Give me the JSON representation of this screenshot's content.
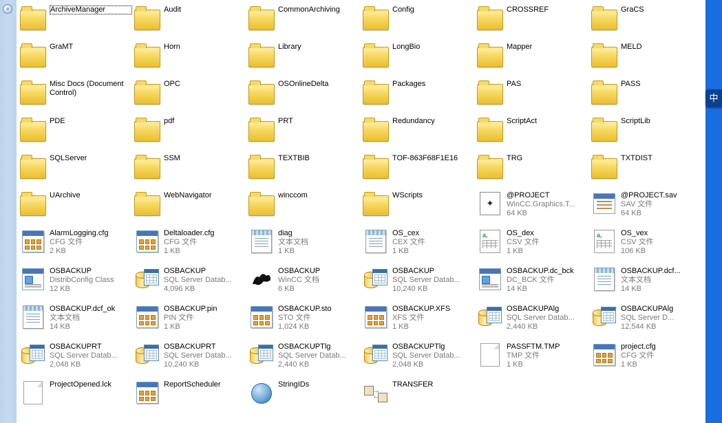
{
  "sticker": "中",
  "items": [
    {
      "name": "ArchiveManager",
      "icon": "folder",
      "dotted": true
    },
    {
      "name": "Audit",
      "icon": "folder"
    },
    {
      "name": "CommonArchiving",
      "icon": "folder"
    },
    {
      "name": "Config",
      "icon": "folder"
    },
    {
      "name": "CROSSREF",
      "icon": "folder"
    },
    {
      "name": "GraCS",
      "icon": "folder"
    },
    {
      "name": "GraMT",
      "icon": "folder"
    },
    {
      "name": "Horn",
      "icon": "folder"
    },
    {
      "name": "Library",
      "icon": "folder"
    },
    {
      "name": "LongBio",
      "icon": "folder"
    },
    {
      "name": "Mapper",
      "icon": "folder"
    },
    {
      "name": "MELD",
      "icon": "folder"
    },
    {
      "name": "Misc Docs (Document Control)",
      "icon": "folder",
      "wrap": true
    },
    {
      "name": "OPC",
      "icon": "folder"
    },
    {
      "name": "OSOnlineDelta",
      "icon": "folder"
    },
    {
      "name": "Packages",
      "icon": "folder"
    },
    {
      "name": "PAS",
      "icon": "folder"
    },
    {
      "name": "PASS",
      "icon": "folder"
    },
    {
      "name": "PDE",
      "icon": "folder"
    },
    {
      "name": "pdf",
      "icon": "folder"
    },
    {
      "name": "PRT",
      "icon": "folder"
    },
    {
      "name": "Redundancy",
      "icon": "folder"
    },
    {
      "name": "ScriptAct",
      "icon": "folder"
    },
    {
      "name": "ScriptLib",
      "icon": "folder"
    },
    {
      "name": "SQLServer",
      "icon": "folder"
    },
    {
      "name": "SSM",
      "icon": "folder"
    },
    {
      "name": "TEXTBIB",
      "icon": "folder"
    },
    {
      "name": "TOF-863F68F1E16",
      "icon": "folder"
    },
    {
      "name": "TRG",
      "icon": "folder"
    },
    {
      "name": "TXTDIST",
      "icon": "folder"
    },
    {
      "name": "UArchive",
      "icon": "folder"
    },
    {
      "name": "WebNavigator",
      "icon": "folder"
    },
    {
      "name": "winccom",
      "icon": "folder"
    },
    {
      "name": "WScripts",
      "icon": "folder"
    },
    {
      "name": "@PROJECT",
      "icon": "gfx",
      "type": "WinCC.Graphics.T...",
      "size": "64 KB"
    },
    {
      "name": "@PROJECT.sav",
      "icon": "sav",
      "type": "SAV 文件",
      "size": "64 KB"
    },
    {
      "name": "AlarmLogging.cfg",
      "icon": "cfg",
      "type": "CFG 文件",
      "size": "2 KB"
    },
    {
      "name": "Deltaloader.cfg",
      "icon": "cfg",
      "type": "CFG 文件",
      "size": "1 KB"
    },
    {
      "name": "diag",
      "icon": "txt",
      "type": "文本文档",
      "size": "1 KB"
    },
    {
      "name": "OS_cex",
      "icon": "txt",
      "type": "CEX 文件",
      "size": "1 KB"
    },
    {
      "name": "OS_dex",
      "icon": "csv",
      "type": "CSV 文件",
      "size": "1 KB"
    },
    {
      "name": "OS_vex",
      "icon": "csv",
      "type": "CSV 文件",
      "size": "106 KB"
    },
    {
      "name": "OSBACKUP",
      "icon": "cfg2",
      "type": "DistribConfig Class",
      "size": "12 KB"
    },
    {
      "name": "OSBACKUP",
      "icon": "db",
      "type": "SQL Server Datab...",
      "size": "4,096 KB"
    },
    {
      "name": "OSBACKUP",
      "icon": "wincc",
      "type": "WinCC 文档",
      "size": "6 KB"
    },
    {
      "name": "OSBACKUP",
      "icon": "db",
      "type": "SQL Server Datab...",
      "size": "10,240 KB"
    },
    {
      "name": "OSBACKUP.dc_bck",
      "icon": "cfg2",
      "type": "DC_BCK 文件",
      "size": "14 KB"
    },
    {
      "name": "OSBACKUP.dcf...",
      "icon": "txt",
      "type": "文本文档",
      "size": "14 KB"
    },
    {
      "name": "OSBACKUP.dcf_ok",
      "icon": "txt",
      "type": "文本文档",
      "size": "14 KB"
    },
    {
      "name": "OSBACKUP.pin",
      "icon": "cfg",
      "type": "PIN 文件",
      "size": "1 KB"
    },
    {
      "name": "OSBACKUP.sto",
      "icon": "cfg",
      "type": "STO 文件",
      "size": "1,024 KB"
    },
    {
      "name": "OSBACKUP.XFS",
      "icon": "cfg",
      "type": "XFS 文件",
      "size": "1 KB"
    },
    {
      "name": "OSBACKUPAlg",
      "icon": "db",
      "type": "SQL Server Datab...",
      "size": "2,440 KB"
    },
    {
      "name": "OSBACKUPAlg",
      "icon": "db",
      "type": "SQL Server D...",
      "size": "12,544 KB"
    },
    {
      "name": "OSBACKUPRT",
      "icon": "db",
      "type": "SQL Server Datab...",
      "size": "2,048 KB"
    },
    {
      "name": "OSBACKUPRT",
      "icon": "db",
      "type": "SQL Server Datab...",
      "size": "10,240 KB"
    },
    {
      "name": "OSBACKUPTlg",
      "icon": "db",
      "type": "SQL Server Datab...",
      "size": "2,440 KB"
    },
    {
      "name": "OSBACKUPTlg",
      "icon": "db",
      "type": "SQL Server Datab...",
      "size": "2,048 KB"
    },
    {
      "name": "PASSFTM.TMP",
      "icon": "sheet",
      "type": "TMP 文件",
      "size": "1 KB"
    },
    {
      "name": "project.cfg",
      "icon": "cfg",
      "type": "CFG 文件",
      "size": "1 KB"
    },
    {
      "name": "ProjectOpened.lck",
      "icon": "sheet"
    },
    {
      "name": "ReportScheduler",
      "icon": "cfg"
    },
    {
      "name": "StringIDs",
      "icon": "globe"
    },
    {
      "name": "TRANSFER",
      "icon": "transfer"
    }
  ]
}
